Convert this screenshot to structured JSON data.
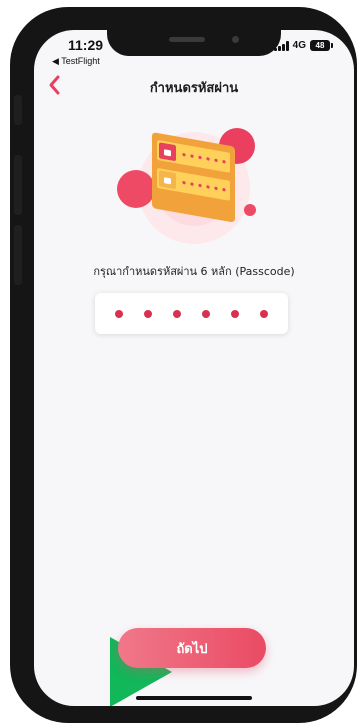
{
  "status_bar": {
    "time": "11:29",
    "back_app": "◀ TestFlight",
    "network": "4G",
    "battery": "48"
  },
  "header": {
    "title": "กำหนดรหัสผ่าน",
    "back_icon": "chevron-left-icon"
  },
  "illustration": {
    "icon": "padlock-passcode-illustration"
  },
  "passcode": {
    "instruction": "กรุณากำหนดรหัสผ่าน 6 หลัก (Passcode)",
    "length": 6,
    "filled": 6
  },
  "actions": {
    "next_label": "ถัดไป"
  },
  "colors": {
    "accent": "#e8405f",
    "dot": "#d6314f",
    "button_start": "#f07889",
    "button_end": "#ea4b64",
    "marker_green": "#12b75a"
  }
}
